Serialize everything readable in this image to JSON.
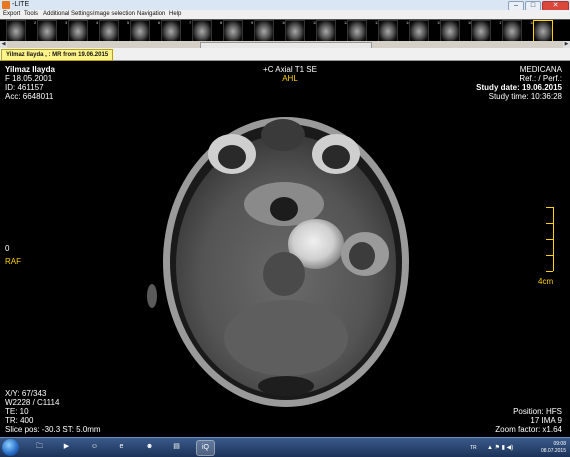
{
  "window": {
    "title": "-LITE"
  },
  "menu": [
    "Export",
    "Tools",
    "Additional Settings",
    "Image selection",
    "Navigation",
    "Help"
  ],
  "thumb_numbers": [
    "2",
    "3",
    "4",
    "5",
    "6",
    "7",
    "8",
    "9",
    "10",
    "11",
    "12",
    "13",
    "14",
    "15",
    "16",
    "17",
    "18"
  ],
  "tab": {
    "label": "Yilmaz Ilayda , : MR from 19.06.2015"
  },
  "overlay": {
    "patient_name": "Yilmaz Ilayda",
    "sex_dob": "F  18.05.2001",
    "id": "ID: 461157",
    "acc": "Acc: 6648011",
    "series": "+C Axial T1 SE",
    "orientation_top": "AHL",
    "institution": "MEDICANA",
    "ref": "Ref.: / Perf.:",
    "study_date": "Study date: 19.06.2015",
    "study_time": "Study time: 10:36:28",
    "left_value": "0",
    "orientation_left": "RAF",
    "scale_label": "4cm",
    "xy": "X/Y: 67/343",
    "window": "W2228 / C1114",
    "te": "TE: 10",
    "tr": "TR: 400",
    "slice": "Slice pos: -30.3  ST: 5.0mm",
    "position": "Position: HFS",
    "ima": "17 IMA 9",
    "zoom": "Zoom factor: x1.64"
  },
  "tray": {
    "lang": "TR",
    "time": "09:08",
    "date": "08.07.2015"
  },
  "colors": {
    "overlay_text": "#ffffff",
    "overlay_accent": "#ffd200",
    "tab_bg": "#fff48a",
    "taskbar": "#1c3258"
  }
}
